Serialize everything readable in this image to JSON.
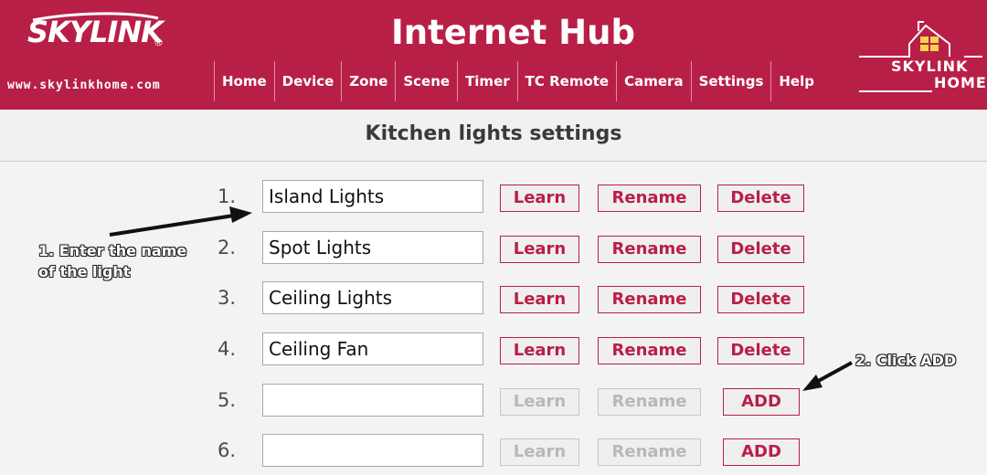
{
  "header": {
    "logo_text": "SKYLINK",
    "logo_mark": "®",
    "site_url": "www.skylinkhome.com",
    "hub_title": "Internet Hub",
    "brand_line1": "SKYLINK",
    "brand_line2": "HOME",
    "brand_color": "#b81f47"
  },
  "nav": [
    {
      "label": "Home"
    },
    {
      "label": "Device"
    },
    {
      "label": "Zone"
    },
    {
      "label": "Scene"
    },
    {
      "label": "Timer"
    },
    {
      "label": "TC Remote"
    },
    {
      "label": "Camera"
    },
    {
      "label": "Settings"
    },
    {
      "label": "Help"
    }
  ],
  "page": {
    "title": "Kitchen lights settings"
  },
  "rows": [
    {
      "num": "1.",
      "value": "Island Lights",
      "learn": "Learn",
      "rename": "Rename",
      "delete": "Delete"
    },
    {
      "num": "2.",
      "value": "Spot Lights",
      "learn": "Learn",
      "rename": "Rename",
      "delete": "Delete"
    },
    {
      "num": "3.",
      "value": "Ceiling Lights",
      "learn": "Learn",
      "rename": "Rename",
      "delete": "Delete"
    },
    {
      "num": "4.",
      "value": "Ceiling Fan",
      "learn": "Learn",
      "rename": "Rename",
      "delete": "Delete"
    },
    {
      "num": "5.",
      "value": "",
      "learn": "Learn",
      "rename": "Rename",
      "add": "ADD"
    },
    {
      "num": "6.",
      "value": "",
      "learn": "Learn",
      "rename": "Rename",
      "add": "ADD"
    }
  ],
  "annotations": {
    "step1_line1": "1. Enter the name",
    "step1_line2": "of the light",
    "step2": "2. Click ADD"
  }
}
